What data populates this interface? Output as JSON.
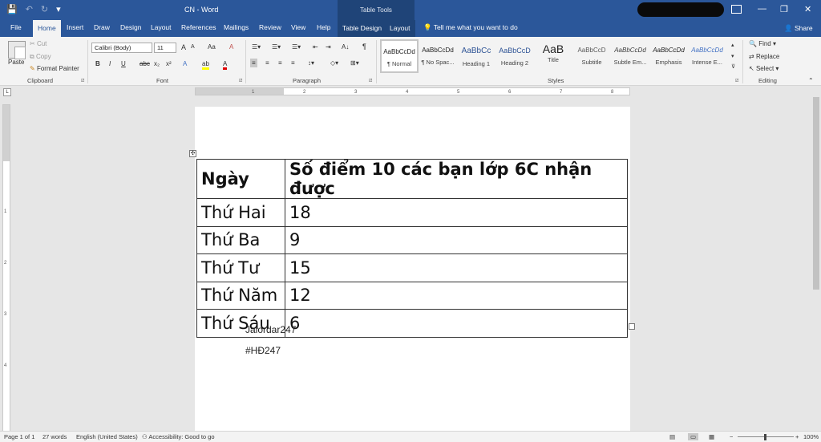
{
  "window": {
    "doc_title": "CN  -  Word",
    "table_tools": "Table Tools",
    "min_glyph": "—",
    "max_glyph": "❐",
    "close_glyph": "✕"
  },
  "qat": {
    "save": "💾",
    "undo": "↶",
    "redo": "↻",
    "more": "▾"
  },
  "tabs": {
    "file": "File",
    "home": "Home",
    "insert": "Insert",
    "draw": "Draw",
    "design": "Design",
    "layout": "Layout",
    "references": "References",
    "mailings": "Mailings",
    "review": "Review",
    "view": "View",
    "help": "Help",
    "table_design": "Table Design",
    "table_layout": "Layout",
    "tell_me": "Tell me what you want to do",
    "share": "Share"
  },
  "ribbon": {
    "clipboard": {
      "paste": "Paste",
      "cut": "Cut",
      "copy": "Copy",
      "format_painter": "Format Painter",
      "label": "Clipboard"
    },
    "font": {
      "name": "Calibri (Body)",
      "size": "11",
      "bold": "B",
      "italic": "I",
      "underline": "U",
      "strike": "abc",
      "sub": "x₂",
      "sup": "x²",
      "grow": "A",
      "shrink": "A",
      "case": "Aa",
      "clear": "A",
      "effects": "A",
      "highlight": "ab",
      "color": "A",
      "label": "Font"
    },
    "paragraph": {
      "label": "Paragraph",
      "pilcrow": "¶",
      "sort": "A↓"
    },
    "styles": {
      "label": "Styles",
      "items": [
        {
          "preview": "AaBbCcDd",
          "name": "¶ Normal"
        },
        {
          "preview": "AaBbCcDd",
          "name": "¶ No Spac..."
        },
        {
          "preview": "AaBbCc",
          "name": "Heading 1"
        },
        {
          "preview": "AaBbCcD",
          "name": "Heading 2"
        },
        {
          "preview": "AaB",
          "name": "Title"
        },
        {
          "preview": "AaBbCcD",
          "name": "Subtitle"
        },
        {
          "preview": "AaBbCcDd",
          "name": "Subtle Em..."
        },
        {
          "preview": "AaBbCcDd",
          "name": "Emphasis"
        },
        {
          "preview": "AaBbCcDd",
          "name": "Intense E..."
        }
      ]
    },
    "editing": {
      "find": "Find",
      "replace": "Replace",
      "select": "Select",
      "label": "Editing"
    }
  },
  "ruler": {
    "h_ticks": [
      "1",
      "2",
      "3",
      "4",
      "5",
      "6",
      "7",
      "8"
    ],
    "v_ticks": [
      "1",
      "2",
      "3",
      "4"
    ],
    "tab_glyph": "L"
  },
  "document": {
    "table": {
      "header": [
        "Ngày",
        "Số điểm 10 các bạn lớp 6C nhận được"
      ],
      "rows": [
        [
          "Thứ Hai",
          "18"
        ],
        [
          "Thứ Ba",
          "9"
        ],
        [
          "Thứ Tư",
          "15"
        ],
        [
          "Thứ Năm",
          "12"
        ],
        [
          "Thứ Sáu",
          "6"
        ]
      ]
    },
    "text_lines": [
      "Jalordar247",
      "#HĐ247"
    ]
  },
  "statusbar": {
    "page": "Page 1 of 1",
    "words": "27 words",
    "language": "English (United States)",
    "accessibility": "Accessibility: Good to go",
    "zoom": "100%",
    "zoom_minus": "−",
    "zoom_plus": "+"
  },
  "colors": {
    "accent": "#2b579a"
  }
}
